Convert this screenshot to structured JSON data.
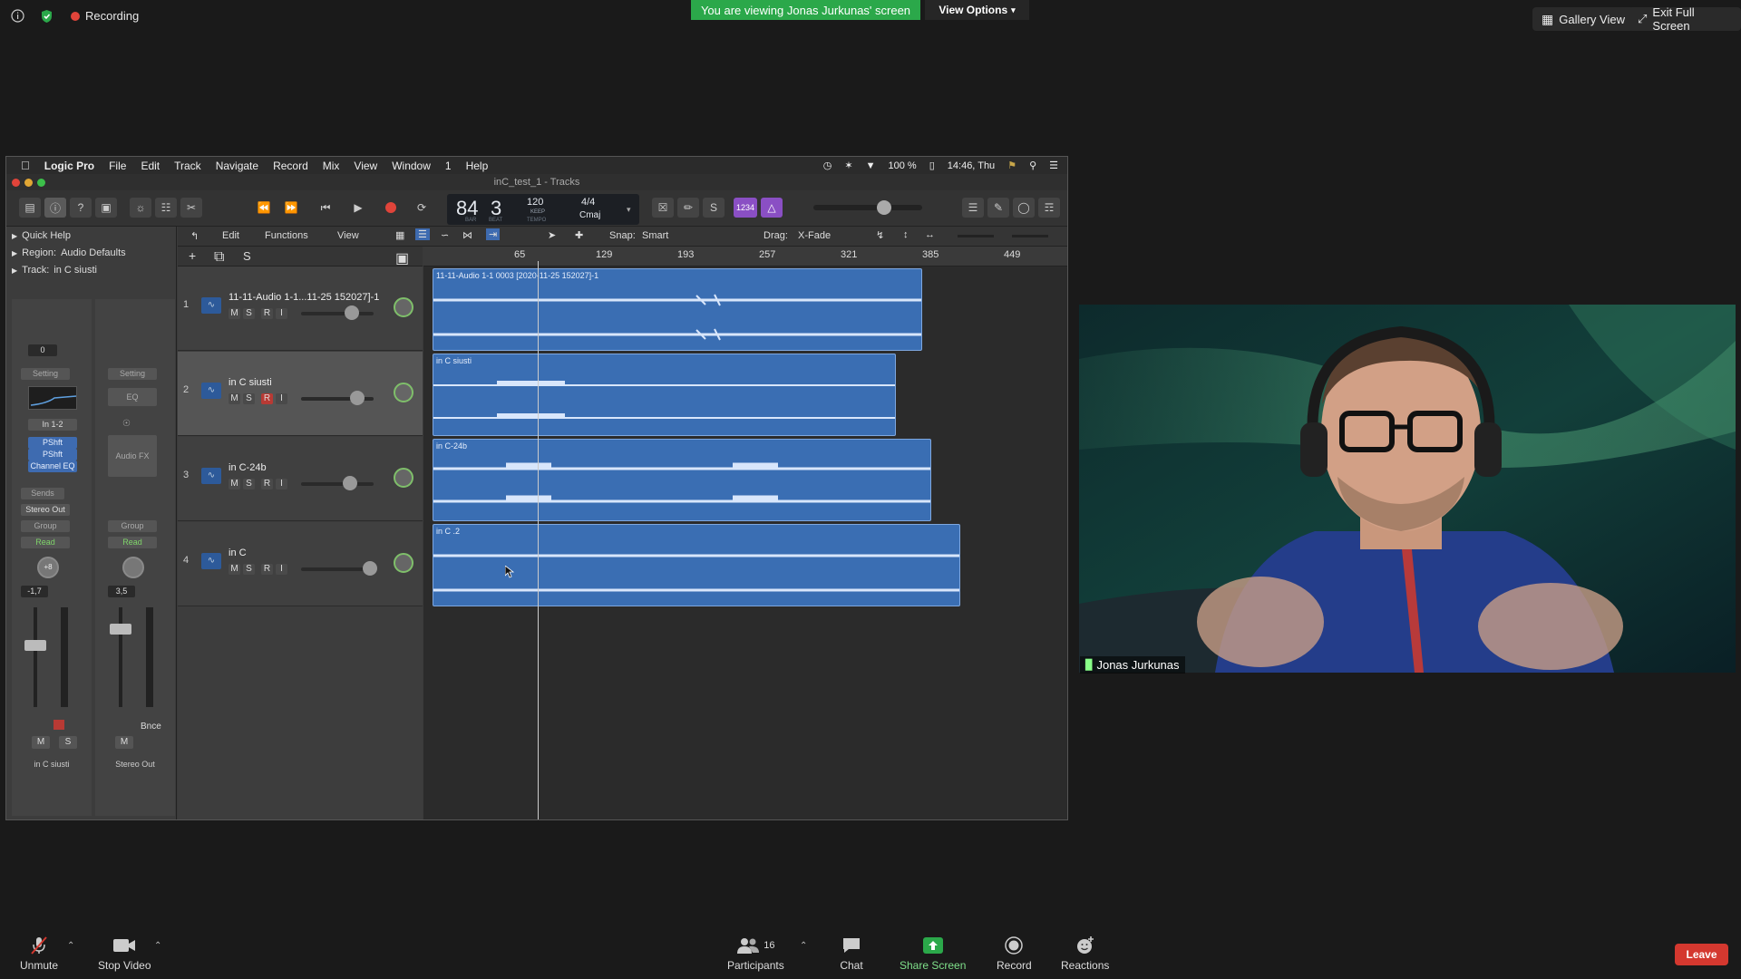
{
  "zoom": {
    "recording_label": "Recording",
    "viewing_banner": "You are viewing Jonas Jurkunas' screen",
    "view_options": "View Options",
    "gallery_view": "Gallery View",
    "exit_fullscreen": "Exit Full Screen",
    "participant_name": "Jonas Jurkunas",
    "bottom": {
      "unmute": "Unmute",
      "stop_video": "Stop Video",
      "participants": "Participants",
      "participants_count": "16",
      "chat": "Chat",
      "share_screen": "Share Screen",
      "record": "Record",
      "reactions": "Reactions",
      "leave": "Leave"
    },
    "colors": {
      "green": "#2ba84a",
      "leave_red": "#d4382f"
    }
  },
  "logic": {
    "menubar": [
      "Logic Pro",
      "File",
      "Edit",
      "Track",
      "Navigate",
      "Record",
      "Mix",
      "View",
      "Window",
      "1",
      "Help"
    ],
    "status": {
      "battery": "100 %",
      "clock": "14:46, Thu"
    },
    "window_title": "inC_test_1 - Tracks",
    "lcd": {
      "bar": "84",
      "beat": "3",
      "bar_label": "BAR",
      "beat_label": "BEAT",
      "tempo": "120",
      "tempo_mode": "KEEP",
      "tempo_label": "TEMPO",
      "signature": "4/4",
      "key": "Cmaj"
    },
    "count_in": "1234",
    "inspector": {
      "quick_help": "Quick Help",
      "region": "Region:",
      "region_value": "Audio Defaults",
      "track": "Track:",
      "track_value": "in C siusti",
      "strip1": {
        "setting": "Setting",
        "input": "In 1-2",
        "plugins": [
          "PShft",
          "PShft",
          "Channel EQ"
        ],
        "sends": "Sends",
        "output": "Stereo Out",
        "group": "Group",
        "automation": "Read",
        "pan_value": "+8",
        "volume": "-1,7",
        "name": "in C siusti",
        "gain": "0"
      },
      "strip2": {
        "setting": "Setting",
        "eq": "EQ",
        "audio_fx": "Audio FX",
        "group": "Group",
        "automation": "Read",
        "volume": "3,5",
        "bounce": "Bnce",
        "name": "Stereo Out"
      }
    },
    "track_toolbar": {
      "edit": "Edit",
      "functions": "Functions",
      "view": "View",
      "snap_label": "Snap:",
      "snap_value": "Smart",
      "drag_label": "Drag:",
      "drag_value": "X-Fade"
    },
    "ruler": [
      "65",
      "129",
      "193",
      "257",
      "321",
      "385",
      "449"
    ],
    "tracks": [
      {
        "num": "1",
        "name": "11-11-Audio 1-1...11-25 152027]-1",
        "region": "11-11-Audio 1-1 0003 [2020-11-25 152027]-1"
      },
      {
        "num": "2",
        "name": "in C siusti",
        "region": "in C siusti"
      },
      {
        "num": "3",
        "name": "in C-24b",
        "region": "in C-24b"
      },
      {
        "num": "4",
        "name": "in C",
        "region": "in C .2"
      }
    ],
    "msri": {
      "m": "M",
      "s": "S",
      "r": "R",
      "i": "I"
    }
  }
}
